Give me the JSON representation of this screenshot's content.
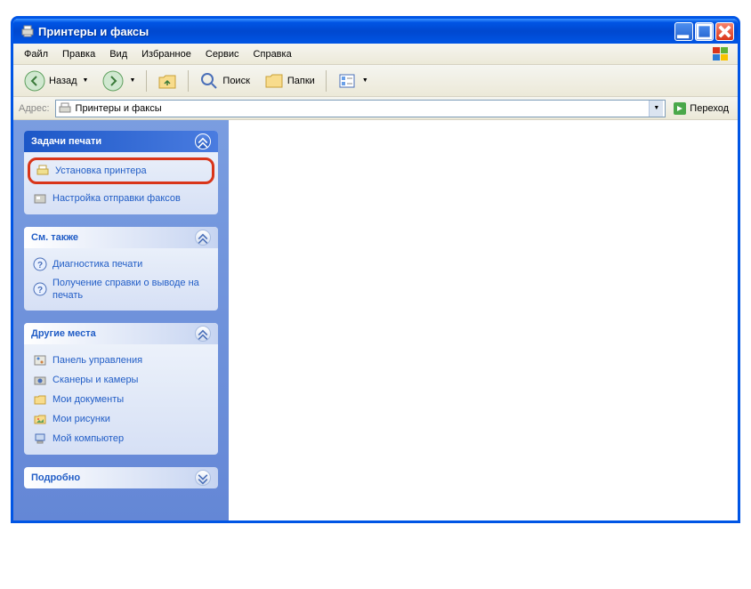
{
  "window": {
    "title": "Принтеры и факсы"
  },
  "menu": {
    "file": "Файл",
    "edit": "Правка",
    "view": "Вид",
    "favorites": "Избранное",
    "tools": "Сервис",
    "help": "Справка"
  },
  "toolbar": {
    "back": "Назад",
    "search": "Поиск",
    "folders": "Папки"
  },
  "address": {
    "label": "Адрес:",
    "value": "Принтеры и факсы",
    "go": "Переход"
  },
  "panels": {
    "tasks": {
      "title": "Задачи печати",
      "install_printer": "Установка принтера",
      "fax_setup": "Настройка отправки факсов"
    },
    "seealso": {
      "title": "См. также",
      "print_diag": "Диагностика печати",
      "print_help": "Получение справки о выводе на печать"
    },
    "other_places": {
      "title": "Другие места",
      "control_panel": "Панель управления",
      "scanners": "Сканеры и камеры",
      "my_docs": "Мои документы",
      "my_pics": "Мои рисунки",
      "my_computer": "Мой компьютер"
    },
    "details": {
      "title": "Подробно"
    }
  }
}
